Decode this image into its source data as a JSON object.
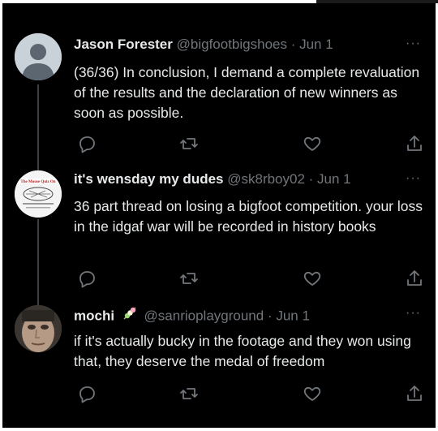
{
  "tweets": [
    {
      "display_name": "Jason Forester",
      "handle": "@bigfootbigshoes",
      "date": "Jun 1",
      "text": "(36/36) In conclusion, I demand a complete revaluation of the results and the declaration of new winners as soon as possible.",
      "avatar": "default-avatar-icon"
    },
    {
      "display_name": "it's wensday my dudes",
      "handle": "@sk8rboy02",
      "date": "Jun 1",
      "text": "36 part thread on losing a bigfoot competition. your loss in the idgaf war will be recorded in history books",
      "avatar_text": "The Mouse Quiz On"
    },
    {
      "display_name": "mochi",
      "handle": "@sanrioplayground",
      "date": "Jun 1",
      "text": "if it's actually bucky in the footage and they won using that, they deserve the medal of freedom",
      "name_emoji": "dango-icon"
    }
  ],
  "separator": " · ",
  "more_glyph": "···",
  "colors": {
    "background": "#000000",
    "text": "#e7e9ea",
    "secondary": "#71767b",
    "thread_line": "#3b3f44"
  },
  "action_icons": [
    "reply-icon",
    "retweet-icon",
    "like-icon",
    "share-icon"
  ]
}
